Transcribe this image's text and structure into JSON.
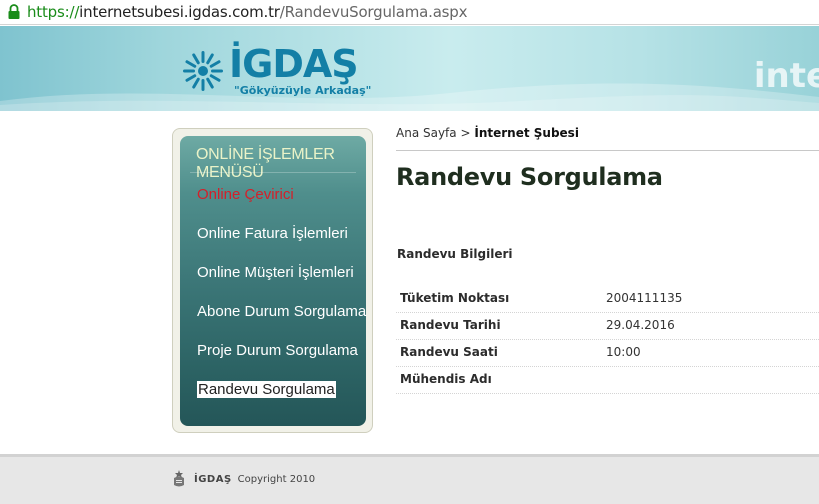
{
  "browser": {
    "url_scheme": "https://",
    "url_host": "internetsubesi.igdas.com.tr",
    "url_path": "/RandevuSorgulama.aspx"
  },
  "header": {
    "brand": "İGDAŞ",
    "slogan": "\"Gökyüzüyle Arkadaş\"",
    "right_text": "inte"
  },
  "menu": {
    "title": "ONLİNE İŞLEMLER MENÜSÜ",
    "items": [
      {
        "label": "Online Çevirici",
        "state": "active"
      },
      {
        "label": "Online Fatura İşlemleri",
        "state": "normal"
      },
      {
        "label": "Online Müşteri İşlemleri",
        "state": "normal"
      },
      {
        "label": "Abone Durum Sorgulama",
        "state": "normal"
      },
      {
        "label": "Proje Durum Sorgulama",
        "state": "normal"
      },
      {
        "label": "Randevu Sorgulama",
        "state": "selected"
      }
    ]
  },
  "breadcrumb": {
    "home": "Ana Sayfa",
    "separator": ">",
    "current": "İnternet Şubesi"
  },
  "page": {
    "title": "Randevu Sorgulama",
    "section_title": "Randevu Bilgileri"
  },
  "info": [
    {
      "label": "Tüketim Noktası",
      "value": "2004111135"
    },
    {
      "label": "Randevu Tarihi",
      "value": "29.04.2016"
    },
    {
      "label": "Randevu Saati",
      "value": "10:00"
    },
    {
      "label": "Mühendis Adı",
      "value": ""
    }
  ],
  "footer": {
    "brand": "İGDAŞ",
    "copyright": "Copyright 2010"
  },
  "colors": {
    "brand_blue": "#137fa6",
    "menu_active_red": "#d4202a",
    "menu_bg": "#2c6364"
  }
}
